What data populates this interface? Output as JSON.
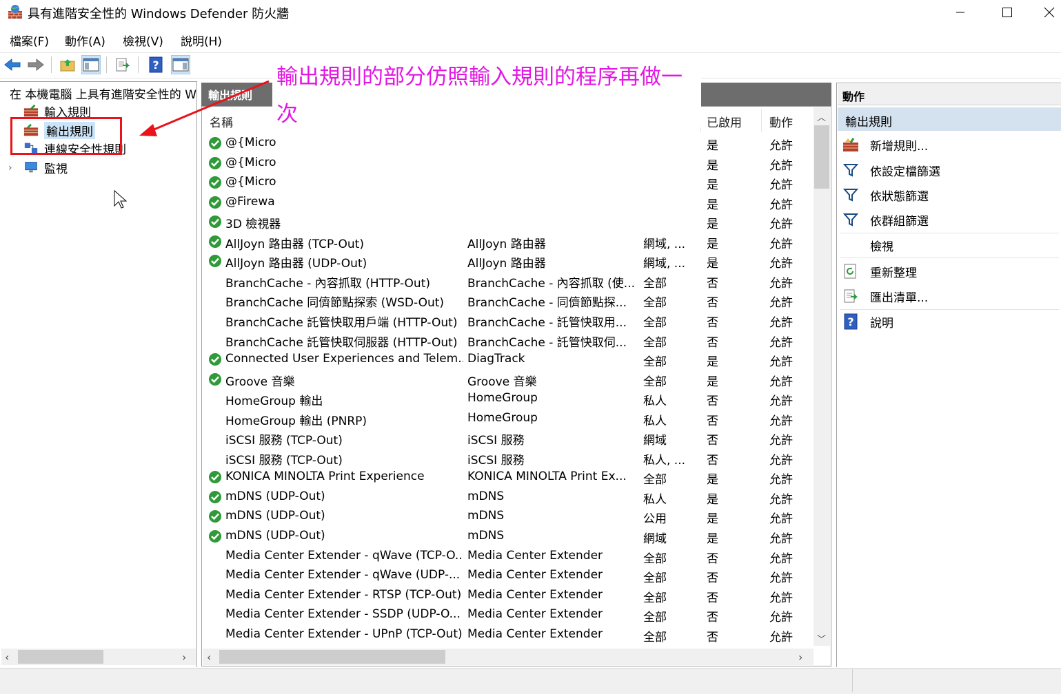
{
  "window": {
    "title": "具有進階安全性的 Windows Defender 防火牆",
    "controls": [
      "minimize",
      "maximize",
      "close"
    ]
  },
  "menu": [
    "檔案(F)",
    "動作(A)",
    "檢視(V)",
    "說明(H)"
  ],
  "toolbar": {
    "buttons": [
      "back-icon",
      "forward-icon",
      "up-folder-icon",
      "show-hide-tree-icon",
      "export-list-icon",
      "help-icon",
      "show-hide-action-icon"
    ],
    "active": [
      "show-hide-tree-icon",
      "show-hide-action-icon"
    ]
  },
  "tree": {
    "root": "在 本機電腦 上具有進階安全性的 Windows Defender 防火牆",
    "items": [
      "輸入規則",
      "輸出規則",
      "連線安全性規則",
      "監視"
    ],
    "selected": "輸出規則"
  },
  "center": {
    "title": "輸出規則",
    "columns": [
      "名稱",
      "已啟用",
      "動作"
    ],
    "rows": [
      {
        "enabled_icon": true,
        "name": "@{Micro",
        "group": "",
        "profile": "",
        "enabled": "是",
        "action": "允許"
      },
      {
        "enabled_icon": true,
        "name": "@{Micro",
        "group": "",
        "profile": "",
        "enabled": "是",
        "action": "允許"
      },
      {
        "enabled_icon": true,
        "name": "@{Micro",
        "group": "",
        "profile": "",
        "enabled": "是",
        "action": "允許"
      },
      {
        "enabled_icon": true,
        "name": "@Firewa",
        "group": "",
        "profile": "",
        "enabled": "是",
        "action": "允許"
      },
      {
        "enabled_icon": true,
        "name": "3D 檢視器",
        "group": "",
        "profile": "",
        "enabled": "是",
        "action": "允許"
      },
      {
        "enabled_icon": true,
        "name": "AllJoyn 路由器 (TCP-Out)",
        "group": "AllJoyn 路由器",
        "profile": "網域, ...",
        "enabled": "是",
        "action": "允許"
      },
      {
        "enabled_icon": true,
        "name": "AllJoyn 路由器 (UDP-Out)",
        "group": "AllJoyn 路由器",
        "profile": "網域, ...",
        "enabled": "是",
        "action": "允許"
      },
      {
        "enabled_icon": false,
        "name": "BranchCache - 內容抓取 (HTTP-Out)",
        "group": "BranchCache - 內容抓取 (使...",
        "profile": "全部",
        "enabled": "否",
        "action": "允許"
      },
      {
        "enabled_icon": false,
        "name": "BranchCache 同儕節點探索 (WSD-Out)",
        "group": "BranchCache - 同儕節點探...",
        "profile": "全部",
        "enabled": "否",
        "action": "允許"
      },
      {
        "enabled_icon": false,
        "name": "BranchCache 託管快取用戶端 (HTTP-Out)",
        "group": "BranchCache - 託管快取用...",
        "profile": "全部",
        "enabled": "否",
        "action": "允許"
      },
      {
        "enabled_icon": false,
        "name": "BranchCache 託管快取伺服器 (HTTP-Out)",
        "group": "BranchCache - 託管快取伺...",
        "profile": "全部",
        "enabled": "否",
        "action": "允許"
      },
      {
        "enabled_icon": true,
        "name": "Connected User Experiences and Telem...",
        "group": "DiagTrack",
        "profile": "全部",
        "enabled": "是",
        "action": "允許"
      },
      {
        "enabled_icon": true,
        "name": "Groove 音樂",
        "group": "Groove 音樂",
        "profile": "全部",
        "enabled": "是",
        "action": "允許"
      },
      {
        "enabled_icon": false,
        "name": "HomeGroup 輸出",
        "group": "HomeGroup",
        "profile": "私人",
        "enabled": "否",
        "action": "允許"
      },
      {
        "enabled_icon": false,
        "name": "HomeGroup 輸出 (PNRP)",
        "group": "HomeGroup",
        "profile": "私人",
        "enabled": "否",
        "action": "允許"
      },
      {
        "enabled_icon": false,
        "name": "iSCSI 服務 (TCP-Out)",
        "group": "iSCSI 服務",
        "profile": "網域",
        "enabled": "否",
        "action": "允許"
      },
      {
        "enabled_icon": false,
        "name": "iSCSI 服務 (TCP-Out)",
        "group": "iSCSI 服務",
        "profile": "私人, ...",
        "enabled": "否",
        "action": "允許"
      },
      {
        "enabled_icon": true,
        "name": "KONICA MINOLTA Print Experience",
        "group": "KONICA MINOLTA Print Ex...",
        "profile": "全部",
        "enabled": "是",
        "action": "允許"
      },
      {
        "enabled_icon": true,
        "name": "mDNS (UDP-Out)",
        "group": "mDNS",
        "profile": "私人",
        "enabled": "是",
        "action": "允許"
      },
      {
        "enabled_icon": true,
        "name": "mDNS (UDP-Out)",
        "group": "mDNS",
        "profile": "公用",
        "enabled": "是",
        "action": "允許"
      },
      {
        "enabled_icon": true,
        "name": "mDNS (UDP-Out)",
        "group": "mDNS",
        "profile": "網域",
        "enabled": "是",
        "action": "允許"
      },
      {
        "enabled_icon": false,
        "name": "Media Center Extender - qWave (TCP-O...",
        "group": "Media Center Extender",
        "profile": "全部",
        "enabled": "否",
        "action": "允許"
      },
      {
        "enabled_icon": false,
        "name": "Media Center Extender - qWave (UDP-...",
        "group": "Media Center Extender",
        "profile": "全部",
        "enabled": "否",
        "action": "允許"
      },
      {
        "enabled_icon": false,
        "name": "Media Center Extender - RTSP (TCP-Out)",
        "group": "Media Center Extender",
        "profile": "全部",
        "enabled": "否",
        "action": "允許"
      },
      {
        "enabled_icon": false,
        "name": "Media Center Extender - SSDP (UDP-O...",
        "group": "Media Center Extender",
        "profile": "全部",
        "enabled": "否",
        "action": "允許"
      },
      {
        "enabled_icon": false,
        "name": "Media Center Extender - UPnP (TCP-Out)",
        "group": "Media Center Extender",
        "profile": "全部",
        "enabled": "否",
        "action": "允許"
      }
    ]
  },
  "actions": {
    "title": "動作",
    "section": "輸出規則",
    "items": [
      {
        "label": "新增規則...",
        "icon": "new-rule-icon"
      },
      {
        "label": "依設定檔篩選",
        "icon": "filter-icon"
      },
      {
        "label": "依狀態篩選",
        "icon": "filter-icon"
      },
      {
        "label": "依群組篩選",
        "icon": "filter-icon"
      },
      {
        "label": "檢視",
        "icon": ""
      },
      {
        "label": "重新整理",
        "icon": "refresh-icon"
      },
      {
        "label": "匯出清單...",
        "icon": "export-list-icon"
      },
      {
        "label": "說明",
        "icon": "help-icon"
      }
    ]
  },
  "annotation": {
    "text": "輸出規則的部分仿照輸入規則的程序再做一次",
    "color": "#e317e3",
    "arrow_color": "#e8131b"
  }
}
